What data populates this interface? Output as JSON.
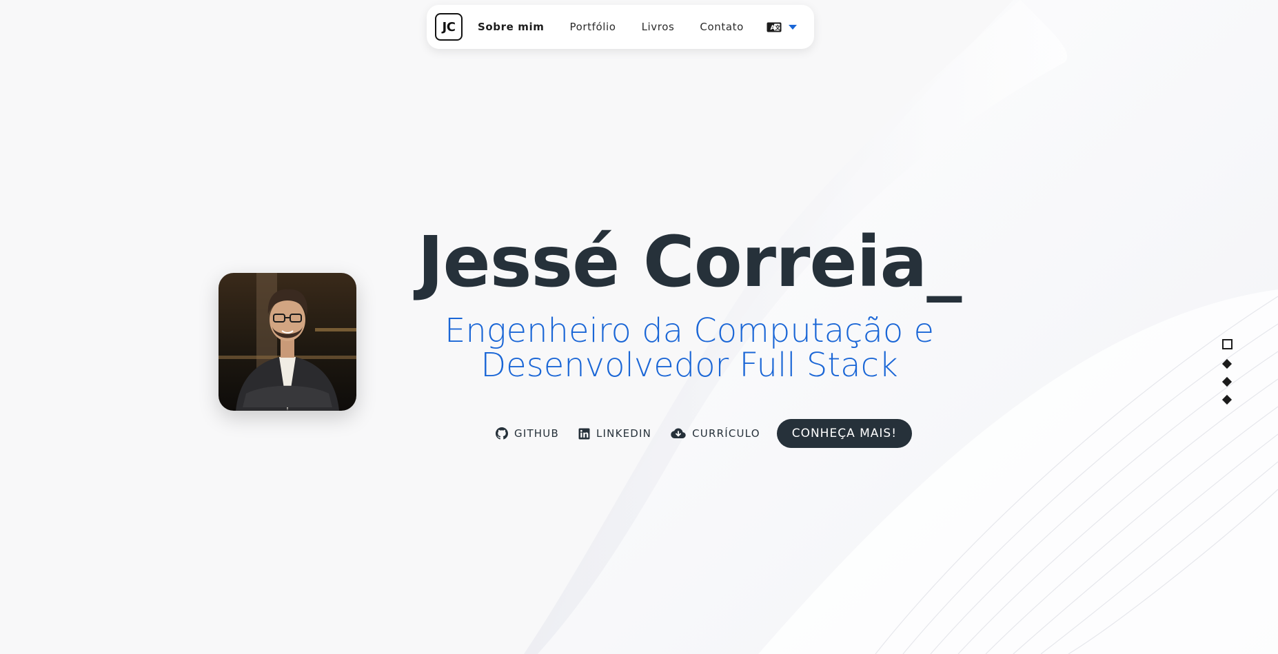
{
  "nav": {
    "logo_text": "JC",
    "links": [
      {
        "label": "Sobre mim",
        "active": true
      },
      {
        "label": "Portfólio",
        "active": false
      },
      {
        "label": "Livros",
        "active": false
      },
      {
        "label": "Contato",
        "active": false
      }
    ],
    "language_icon": "translate-icon"
  },
  "hero": {
    "name": "Jessé Correia_",
    "subtitle_line1": "Engenheiro da Computação e",
    "subtitle_line2": "Desenvolvedor Full Stack",
    "photo_alt": "profile-photo"
  },
  "actions": {
    "github": {
      "label": "GITHUB",
      "icon": "github-icon"
    },
    "linkedin": {
      "label": "LINKEDIN",
      "icon": "linkedin-icon"
    },
    "resume": {
      "label": "CURRÍCULO",
      "icon": "cloud-download-icon"
    },
    "cta": "CONHEÇA MAIS!"
  },
  "section_dots": {
    "count": 4,
    "active_index": 0
  },
  "colors": {
    "accent": "#1a66d6",
    "dark": "#26313a",
    "background": "#f8f8f9"
  }
}
